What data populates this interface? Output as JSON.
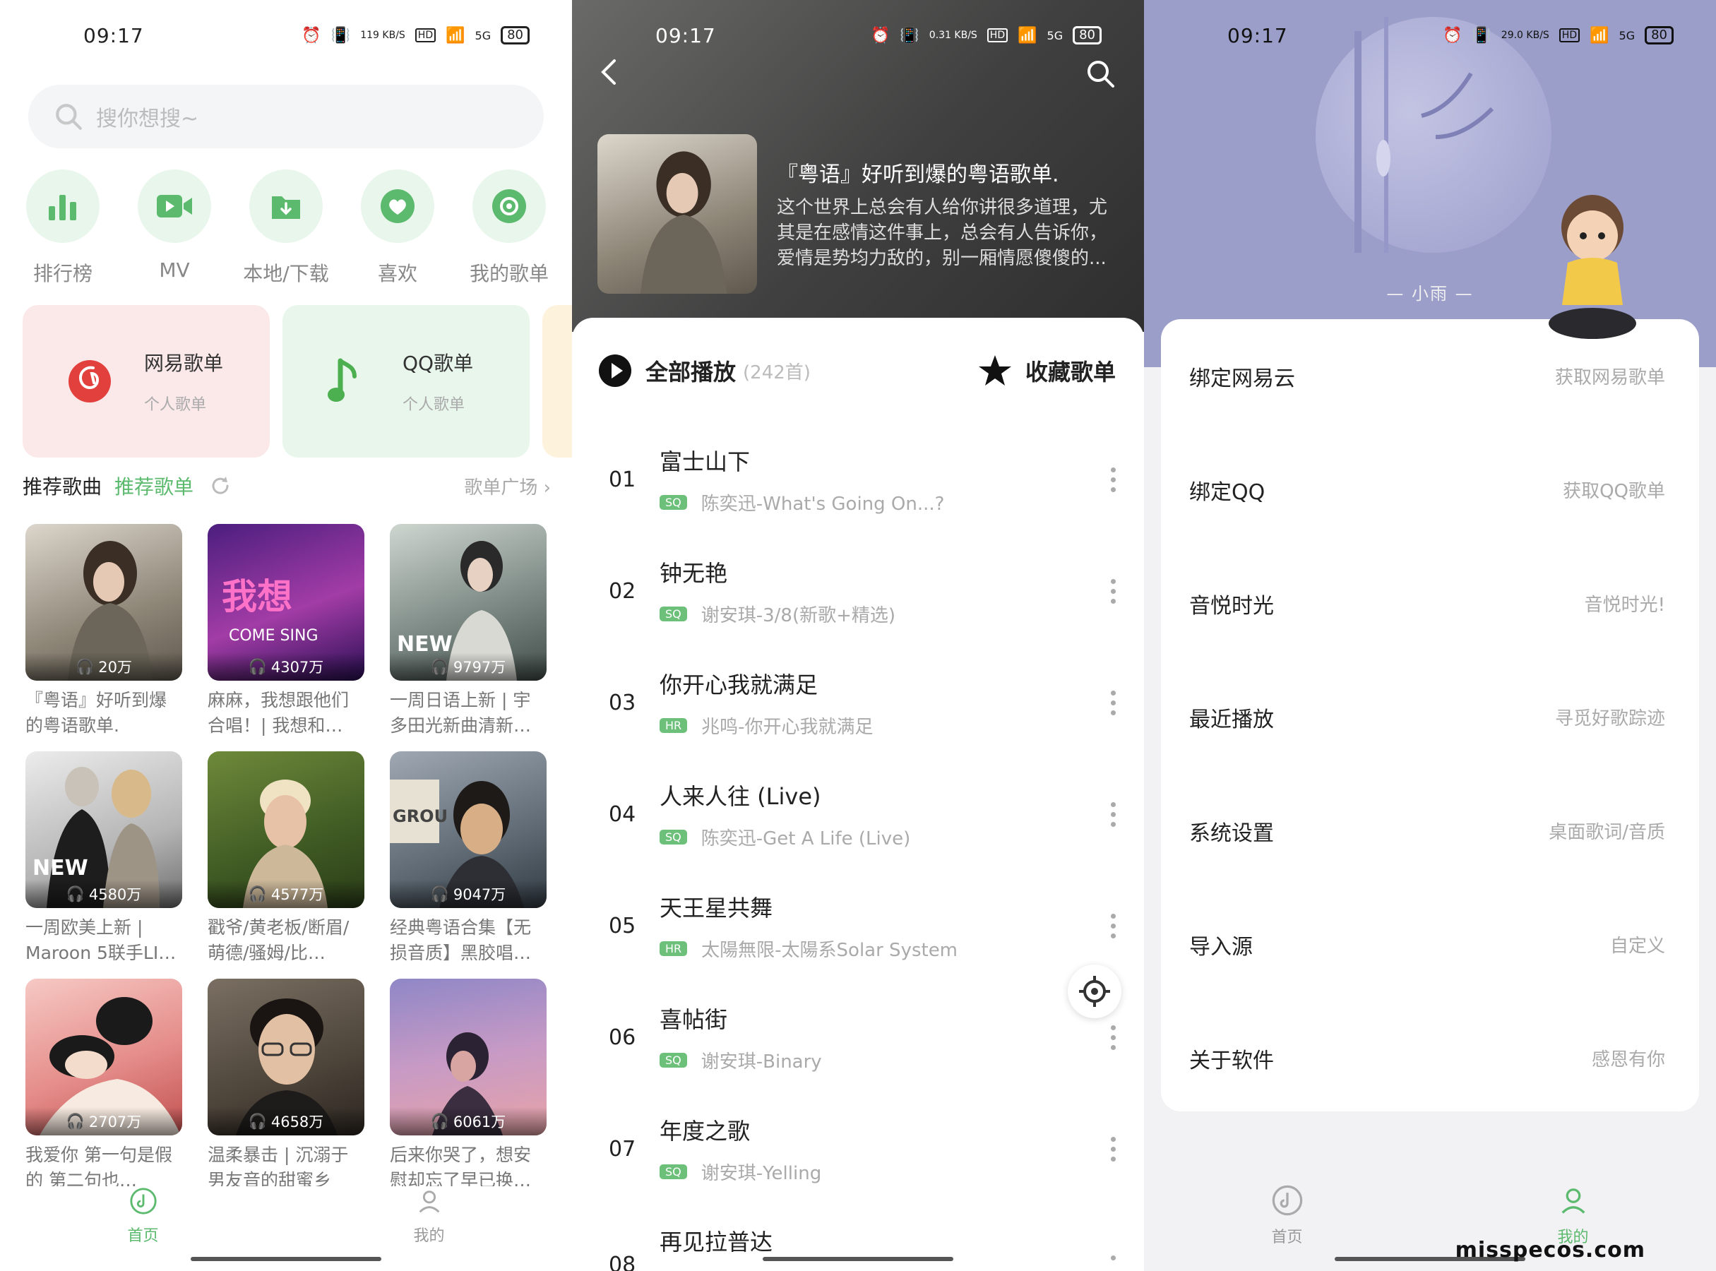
{
  "status": {
    "time": "09:17",
    "battery": "80",
    "speeds": [
      "119 KB/S",
      "0.31 KB/S",
      "29.0 KB/S"
    ],
    "hd": "HD",
    "net": "5G"
  },
  "home": {
    "search_placeholder": "搜你想搜~",
    "quick": [
      "排行榜",
      "MV",
      "本地/下载",
      "喜欢",
      "我的歌单"
    ],
    "cards": [
      {
        "title": "网易歌单",
        "sub": "个人歌单"
      },
      {
        "title": "QQ歌单",
        "sub": "个人歌单"
      }
    ],
    "section": {
      "tab1": "推荐歌曲",
      "tab2": "推荐歌单",
      "more": "歌单广场 ›"
    },
    "playlists": [
      {
        "count": "20万",
        "title": "『粤语』好听到爆的粤语歌单."
      },
      {
        "count": "4307万",
        "title": "麻麻，我想跟他们合唱！| 我想和…"
      },
      {
        "count": "9797万",
        "title": "一周日语上新 | 宇多田光新曲清新…"
      },
      {
        "count": "4580万",
        "title": "一周欧美上新 | Maroon 5联手LI…"
      },
      {
        "count": "4577万",
        "title": "戳爷/黄老板/断眉/萌德/骚姆/比…"
      },
      {
        "count": "9047万",
        "title": "经典粤语合集【无损音质】黑胶唱…"
      },
      {
        "count": "2707万",
        "title": "我爱你 第一句是假的 第二句也…"
      },
      {
        "count": "4658万",
        "title": "温柔暴击 | 沉溺于男友音的甜蜜乡"
      },
      {
        "count": "6061万",
        "title": "后来你哭了，想安慰却忘了早已换…"
      }
    ],
    "tabs": [
      "首页",
      "我的"
    ]
  },
  "detail": {
    "title": "『粤语』好听到爆的粤语歌单.",
    "desc": "这个世界上总会有人给你讲很多道理，尤其是在感情这件事上，总会有人告诉你，爱情是势均力敌的，别一厢情愿傻傻的...",
    "play_all": "全部播放",
    "count": "(242首)",
    "fav": "收藏歌单",
    "songs": [
      {
        "num": "01",
        "name": "富士山下",
        "tag": "SQ",
        "sub": "陈奕迅-What's Going On...?"
      },
      {
        "num": "02",
        "name": "钟无艳",
        "tag": "SQ",
        "sub": "谢安琪-3/8(新歌+精选)"
      },
      {
        "num": "03",
        "name": "你开心我就满足",
        "tag": "HR",
        "sub": "兆鸣-你开心我就满足"
      },
      {
        "num": "04",
        "name": "人来人往 (Live)",
        "tag": "SQ",
        "sub": "陈奕迅-Get A Life (Live)"
      },
      {
        "num": "05",
        "name": "天王星共舞",
        "tag": "HR",
        "sub": "太陽無限-太陽系Solar System"
      },
      {
        "num": "06",
        "name": "喜帖街",
        "tag": "SQ",
        "sub": "谢安琪-Binary"
      },
      {
        "num": "07",
        "name": "年度之歌",
        "tag": "SQ",
        "sub": "谢安琪-Yelling"
      },
      {
        "num": "08",
        "name": "再见拉普达",
        "tag": "",
        "sub": ""
      }
    ]
  },
  "mine": {
    "name": "— 小雨 —",
    "menu": [
      {
        "label": "绑定网易云",
        "value": "获取网易歌单"
      },
      {
        "label": "绑定QQ",
        "value": "获取QQ歌单"
      },
      {
        "label": "音悦时光",
        "value": "音悦时光!"
      },
      {
        "label": "最近播放",
        "value": "寻觅好歌踪迹"
      },
      {
        "label": "系统设置",
        "value": "桌面歌词/音质"
      },
      {
        "label": "导入源",
        "value": "自定义"
      },
      {
        "label": "关于软件",
        "value": "感恩有你"
      }
    ],
    "tabs": [
      "首页",
      "我的"
    ],
    "watermark": "misspecos.com"
  },
  "colors": {
    "accent": "#5cba6e",
    "card_red": "#fbe9ea",
    "card_green": "#e8f6ec",
    "header_purple": "#9b9ec9"
  }
}
